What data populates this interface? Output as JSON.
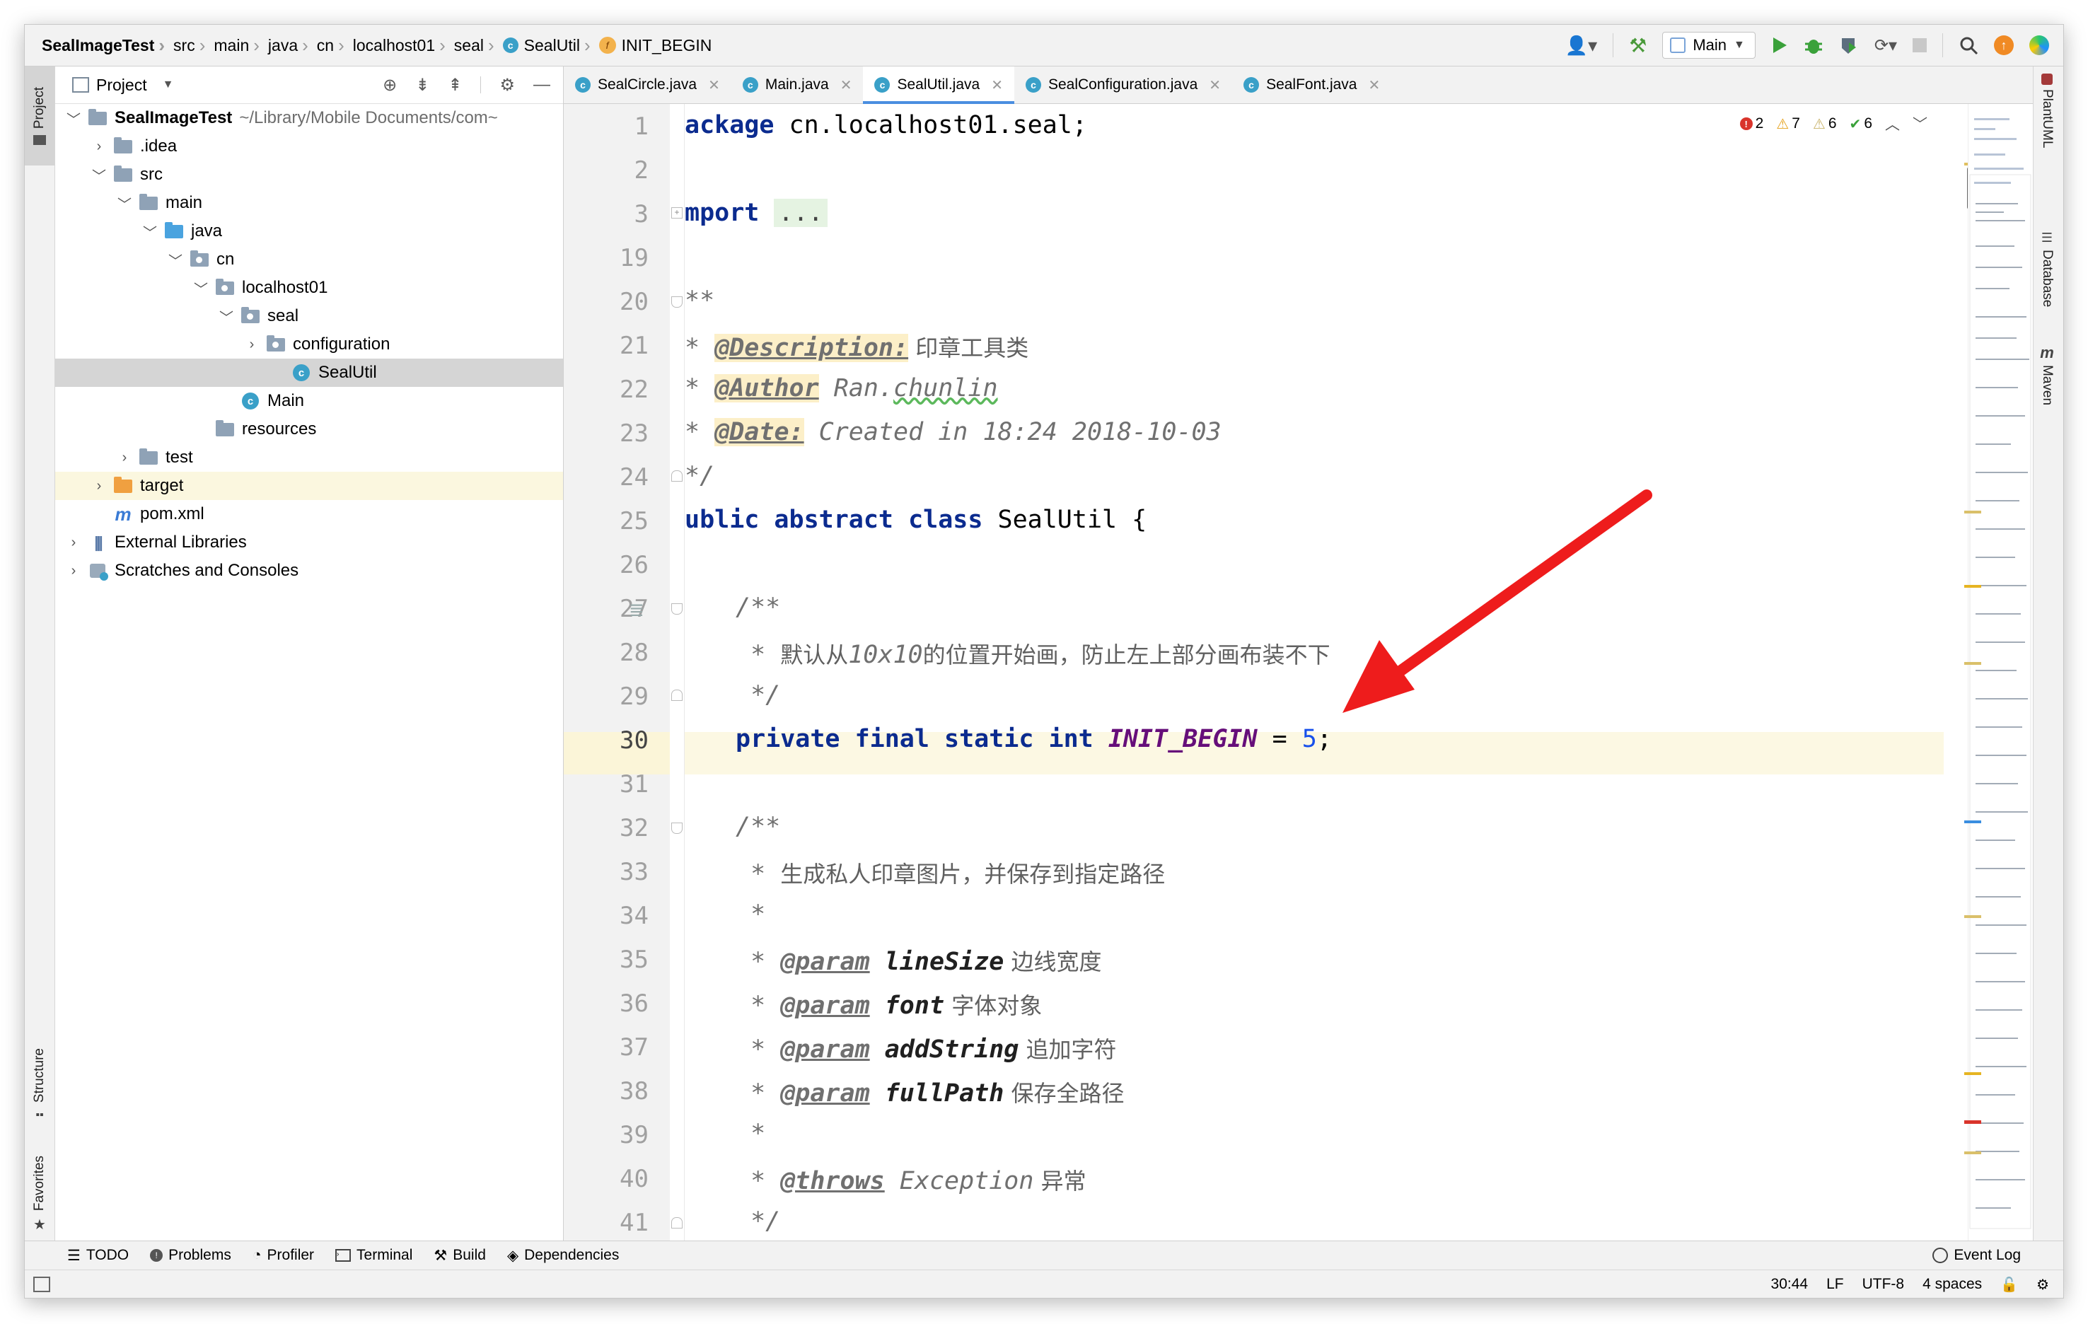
{
  "breadcrumbs": [
    "SealImageTest",
    "src",
    "main",
    "java",
    "cn",
    "localhost01",
    "seal",
    "SealUtil",
    "INIT_BEGIN"
  ],
  "run_config": "Main",
  "left_stripe": {
    "project": "Project",
    "structure": "Structure",
    "favorites": "Favorites"
  },
  "right_stripe": {
    "plantuml": "PlantUML",
    "database": "Database",
    "maven": "Maven"
  },
  "project_panel": {
    "title": "Project",
    "tree": [
      {
        "label": "SealImageTest",
        "path": "~/Library/Mobile Documents/com~"
      },
      {
        "label": ".idea"
      },
      {
        "label": "src"
      },
      {
        "label": "main"
      },
      {
        "label": "java"
      },
      {
        "label": "cn"
      },
      {
        "label": "localhost01"
      },
      {
        "label": "seal"
      },
      {
        "label": "configuration"
      },
      {
        "label": "SealUtil"
      },
      {
        "label": "Main"
      },
      {
        "label": "resources"
      },
      {
        "label": "test"
      },
      {
        "label": "target"
      },
      {
        "label": "pom.xml"
      },
      {
        "label": "External Libraries"
      },
      {
        "label": "Scratches and Consoles"
      }
    ]
  },
  "tabs": [
    "SealCircle.java",
    "Main.java",
    "SealUtil.java",
    "SealConfiguration.java",
    "SealFont.java"
  ],
  "active_tab": "SealUtil.java",
  "inspections": {
    "errors": "2",
    "warnings": "7",
    "weak_warnings": "6",
    "typos": "6"
  },
  "line_numbers": [
    "1",
    "2",
    "3",
    "19",
    "20",
    "21",
    "22",
    "23",
    "24",
    "25",
    "26",
    "27",
    "28",
    "29",
    "30",
    "31",
    "32",
    "33",
    "34",
    "35",
    "36",
    "37",
    "38",
    "39",
    "40",
    "41"
  ],
  "code": {
    "l1_kw": "ackage",
    "l1_rest": " cn.localhost01.seal;",
    "l3_kw": "mport",
    "l3_dots": "...",
    "l20": "**",
    "l21_star": "* ",
    "l21_tag": "@Description:",
    "l21_text": " 印章工具类",
    "l22_star": "* ",
    "l22_tag": "@Author",
    "l22_text1": " Ran.",
    "l22_text2": "chunlin",
    "l23_star": "* ",
    "l23_tag": "@Date:",
    "l23_text": " Created in 18:24 2018-10-03",
    "l24": "*/",
    "l25_kw": "ublic abstract class",
    "l25_rest": " SealUtil {",
    "l27": "/**",
    "l28_star": " * ",
    "l28_text1": "默认从",
    "l28_text2": "10x10",
    "l28_text3": "的位置开始画，防止左上部分画布装不下",
    "l29": " */",
    "l30_kw": "private final static int",
    "l30_field": "INIT_BEGIN",
    "l30_eq": " = ",
    "l30_num": "5",
    "l30_end": ";",
    "l32": "/**",
    "l33_star": " * ",
    "l33_text": "生成私人印章图片，并保存到指定路径",
    "l34": " *",
    "l35_star": " * ",
    "l35_tag": "@param",
    "l35_name": " lineSize",
    "l35_text": " 边线宽度",
    "l36_star": " * ",
    "l36_tag": "@param",
    "l36_name": " font",
    "l36_text": " 字体对象",
    "l37_star": " * ",
    "l37_tag": "@param",
    "l37_name": " addString",
    "l37_text": " 追加字符",
    "l38_star": " * ",
    "l38_tag": "@param",
    "l38_name": " fullPath",
    "l38_text": " 保存全路径",
    "l39": " *",
    "l40_star": " * ",
    "l40_tag": "@throws",
    "l40_name": " Exception",
    "l40_text": " 异常",
    "l41": " */"
  },
  "bottom_tools": [
    "TODO",
    "Problems",
    "Profiler",
    "Terminal",
    "Build",
    "Dependencies"
  ],
  "event_log": "Event Log",
  "status_bar": {
    "position": "30:44",
    "line_sep": "LF",
    "encoding": "UTF-8",
    "indent": "4 spaces"
  },
  "colors": {
    "keyword": "#0b2b8f",
    "field": "#660e7a",
    "number": "#1750eb",
    "current_line": "#fcf8e3",
    "arrow": "#ee1c1c",
    "tab_underline": "#4a8ee0"
  }
}
